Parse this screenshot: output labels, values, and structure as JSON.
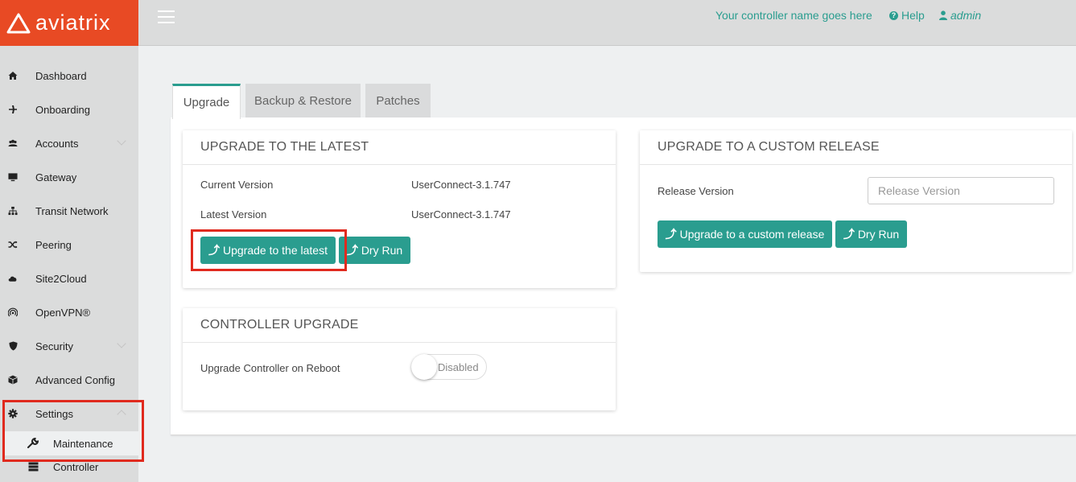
{
  "brand": {
    "name": "aviatrix"
  },
  "topbar": {
    "controller_name": "Your controller name goes here",
    "help_label": "Help",
    "user_label": "admin"
  },
  "sidebar": {
    "items": [
      {
        "label": "Dashboard",
        "icon": "home-icon"
      },
      {
        "label": "Onboarding",
        "icon": "plane-icon"
      },
      {
        "label": "Accounts",
        "icon": "users-icon"
      },
      {
        "label": "Gateway",
        "icon": "monitor-icon"
      },
      {
        "label": "Transit Network",
        "icon": "sitemap-icon"
      },
      {
        "label": "Peering",
        "icon": "shuffle-icon"
      },
      {
        "label": "Site2Cloud",
        "icon": "cloud-icon"
      },
      {
        "label": "OpenVPN®",
        "icon": "signal-icon"
      },
      {
        "label": "Security",
        "icon": "shield-icon"
      },
      {
        "label": "Advanced Config",
        "icon": "cube-icon"
      },
      {
        "label": "Settings",
        "icon": "gear-icon"
      }
    ],
    "sub_items": [
      {
        "label": "Maintenance",
        "icon": "wrench-icon",
        "active": true
      },
      {
        "label": "Controller",
        "icon": "server-icon"
      }
    ]
  },
  "tabs": [
    {
      "label": "Upgrade",
      "active": true
    },
    {
      "label": "Backup & Restore"
    },
    {
      "label": "Patches"
    }
  ],
  "upgrade_latest": {
    "title": "UPGRADE TO THE LATEST",
    "current_version_label": "Current Version",
    "current_version": "UserConnect-3.1.747",
    "latest_version_label": "Latest Version",
    "latest_version": "UserConnect-3.1.747",
    "upgrade_button": "Upgrade to the latest",
    "dry_run_button": "Dry Run"
  },
  "upgrade_custom": {
    "title": "UPGRADE TO A CUSTOM RELEASE",
    "release_version_label": "Release Version",
    "release_version_placeholder": "Release Version",
    "release_version_value": "",
    "upgrade_button": "Upgrade to a custom release",
    "dry_run_button": "Dry Run"
  },
  "controller_upgrade": {
    "title": "CONTROLLER UPGRADE",
    "reboot_label": "Upgrade Controller on Reboot",
    "toggle_state": "Disabled"
  },
  "colors": {
    "brand": "#e84a24",
    "accent": "#2a9d8f",
    "highlight": "#e02a1e"
  }
}
